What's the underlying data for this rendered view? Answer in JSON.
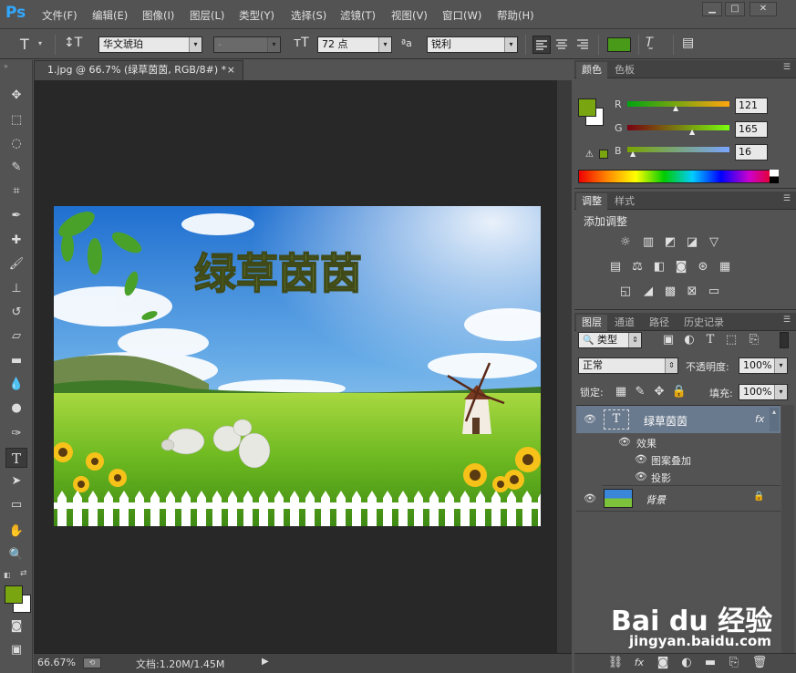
{
  "app": {
    "logo": "Ps"
  },
  "menu": [
    "文件(F)",
    "编辑(E)",
    "图像(I)",
    "图层(L)",
    "类型(Y)",
    "选择(S)",
    "滤镜(T)",
    "视图(V)",
    "窗口(W)",
    "帮助(H)"
  ],
  "window_controls": [
    "▁",
    "□",
    "✕"
  ],
  "options": {
    "tool_glyph": "T",
    "font_family": "华文琥珀",
    "font_style": "-",
    "font_size": "72 点",
    "aa_label": "ªa",
    "antialias": "锐利",
    "text_color": "#4a9a1a"
  },
  "document": {
    "tab_title": "1.jpg @ 66.7% (绿草茵茵, RGB/8#) *",
    "close": "×",
    "headline": "绿草茵茵"
  },
  "status": {
    "zoom": "66.67%",
    "doc_label": "文档:1.20M/1.45M"
  },
  "colors": {
    "foreground": "#79a510",
    "background": "#ffffff"
  },
  "color_panel": {
    "tabs": [
      "颜色",
      "色板"
    ],
    "channels": [
      {
        "label": "R",
        "value": "121"
      },
      {
        "label": "G",
        "value": "165"
      },
      {
        "label": "B",
        "value": "16"
      }
    ]
  },
  "adjust_panel": {
    "tabs": [
      "调整",
      "样式"
    ],
    "title": "添加调整"
  },
  "layers_panel": {
    "tabs": [
      "图层",
      "通道",
      "路径",
      "历史记录"
    ],
    "filter": "类型",
    "blend": "正常",
    "opacity_label": "不透明度:",
    "opacity": "100%",
    "lock_label": "锁定:",
    "fill_label": "填充:",
    "fill": "100%",
    "layers": [
      {
        "name": "绿草茵茵",
        "type": "T",
        "fx": "fx"
      },
      {
        "name": "效果"
      },
      {
        "name": "图案叠加"
      },
      {
        "name": "投影"
      },
      {
        "name": "背景"
      }
    ]
  },
  "watermark": {
    "brand": "Bai du 经验",
    "url": "jingyan.baidu.com"
  }
}
